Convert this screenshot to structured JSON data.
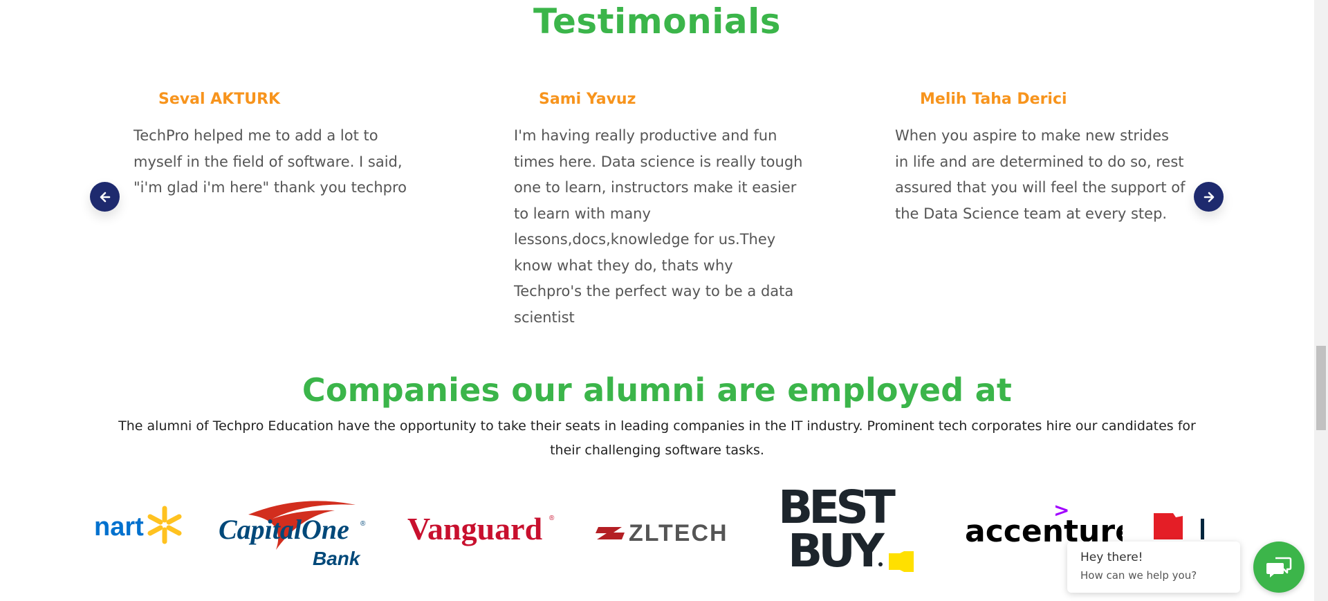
{
  "testimonials": {
    "title": "Testimonials",
    "items": [
      {
        "name": "Seval AKTURK",
        "text": "TechPro helped me to add a lot to myself in the field of software. I said, \"i'm glad i'm here\" thank you techpro"
      },
      {
        "name": "Sami Yavuz",
        "text": "I'm having really productive and fun times here. Data science is really tough one to learn, instructors make it easier to learn with many lessons,docs,knowledge for us.They know what they do, thats why Techpro's the perfect way to be a data scientist"
      },
      {
        "name": "Melih Taha Derici",
        "text": "When you aspire to make new strides in life and are determined to do so, rest assured that you will feel the support of the Data Science team at every step."
      }
    ],
    "prev_icon": "arrow-left-icon",
    "next_icon": "arrow-right-icon"
  },
  "companies": {
    "title": "Companies our alumni are employed at",
    "description": "The alumni of Techpro Education have the opportunity to take their seats in leading companies in the IT industry. Prominent tech corporates hire our candidates for their challenging software tasks.",
    "logos": {
      "walmart": "nart",
      "capitalone_main": "CapitalOne",
      "capitalone_reg": "®",
      "capitalone_sub": "Bank",
      "vanguard": "Vanguard",
      "vanguard_reg": "®",
      "zltech": "ZLTECH",
      "bestbuy_line1": "BEST",
      "bestbuy_line2": "BUY",
      "accenture": "accenture",
      "accenture_mark": ">"
    }
  },
  "chat": {
    "greeting": "Hey there!",
    "prompt": "How can we help you?"
  },
  "colors": {
    "heading_green": "#3bb54a",
    "name_orange": "#f7941d",
    "arrow_navy": "#1e2a6e",
    "chat_green": "#3cb54a"
  }
}
